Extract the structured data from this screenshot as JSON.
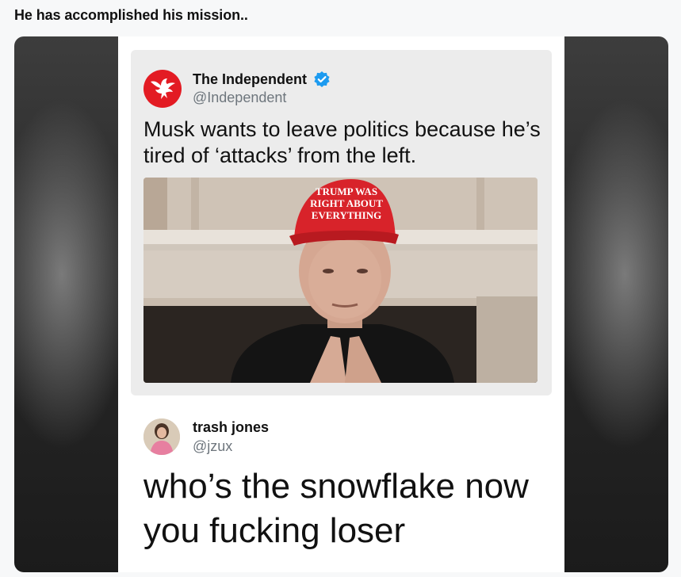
{
  "post": {
    "title": "He has accomplished his mission.."
  },
  "quoted_tweet": {
    "display_name": "The Independent",
    "handle": "@Independent",
    "verified": true,
    "text": "Musk wants to leave politics because he’s tired of ‘attacks’ from the left.",
    "avatar_icon": "eagle-icon",
    "avatar_color": "#e31b23",
    "photo": {
      "hat_text": [
        "TRUMP WAS",
        "RIGHT ABOUT",
        "EVERYTHING"
      ],
      "hat_color": "#d8232a"
    }
  },
  "reply_tweet": {
    "display_name": "trash jones",
    "handle": "@jzux",
    "text": "who’s the snowflake now you fucking loser",
    "avatar_icon": "profile-photo"
  },
  "colors": {
    "verified_badge": "#1d9bf0",
    "handle_gray": "#6e767d"
  }
}
